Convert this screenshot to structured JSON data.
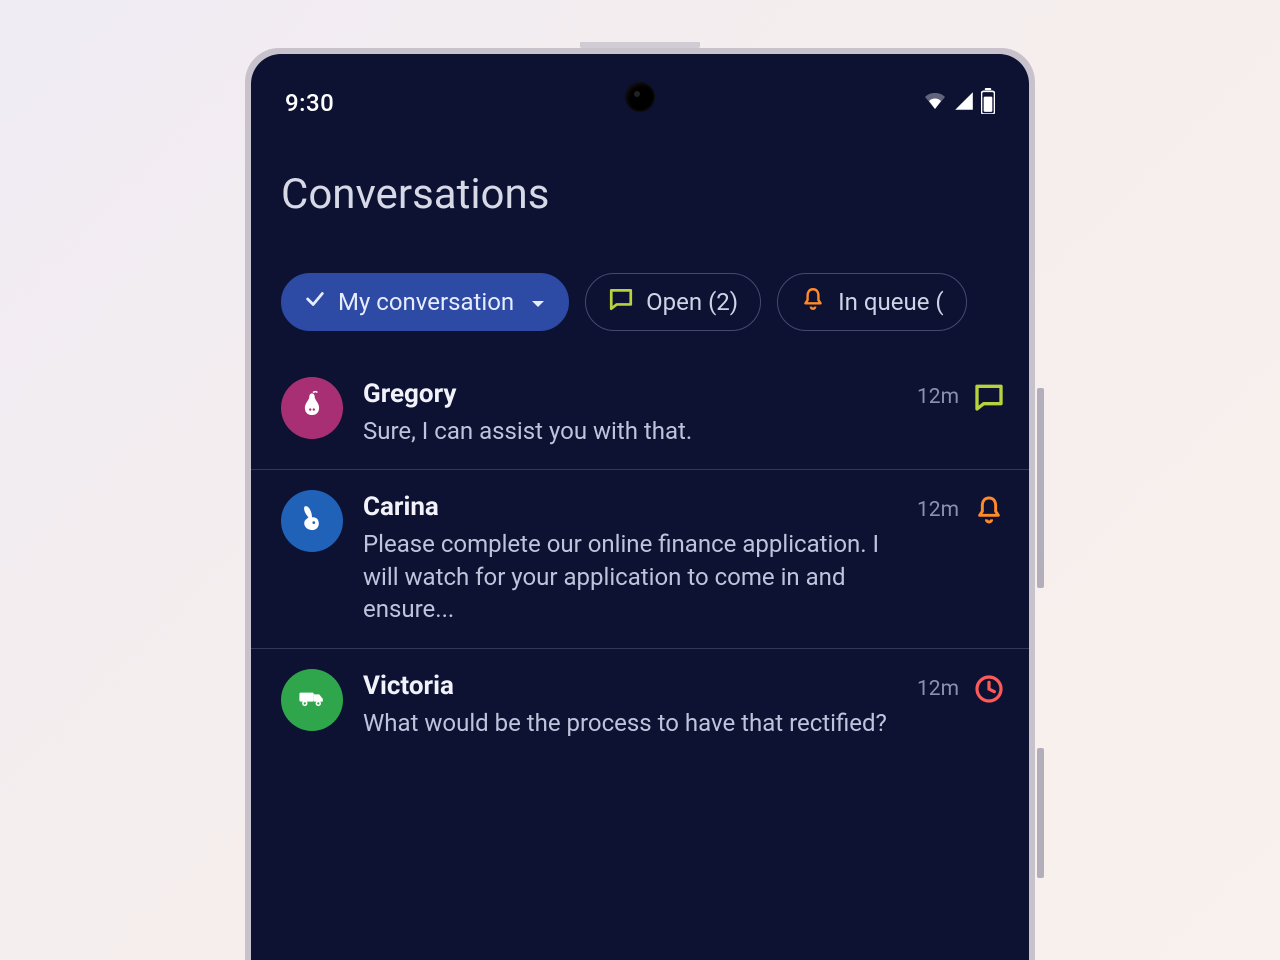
{
  "statusbar": {
    "time": "9:30"
  },
  "title": "Conversations",
  "filters": {
    "my_conversation": "My conversation",
    "open": "Open (2)",
    "in_queue": "In queue ("
  },
  "colors": {
    "chip_active_bg": "#2d4aa5",
    "open_icon": "#b7d23a",
    "bell_icon": "#ff8a2a",
    "clock_icon": "#ff5a5a"
  },
  "conversations": [
    {
      "name": "Gregory",
      "preview": "Sure, I can assist you with that.",
      "time": "12m",
      "status_icon": "chat",
      "avatar_color": "#a92f74",
      "avatar_icon": "pear"
    },
    {
      "name": "Carina",
      "preview": "Please complete our online finance application. I will watch for your application to come in and ensure...",
      "time": "12m",
      "status_icon": "bell",
      "avatar_color": "#1f62b8",
      "avatar_icon": "rabbit"
    },
    {
      "name": "Victoria",
      "preview": "What would be the process to have that rectified?",
      "time": "12m",
      "status_icon": "clock",
      "avatar_color": "#2fa64b",
      "avatar_icon": "truck"
    }
  ]
}
